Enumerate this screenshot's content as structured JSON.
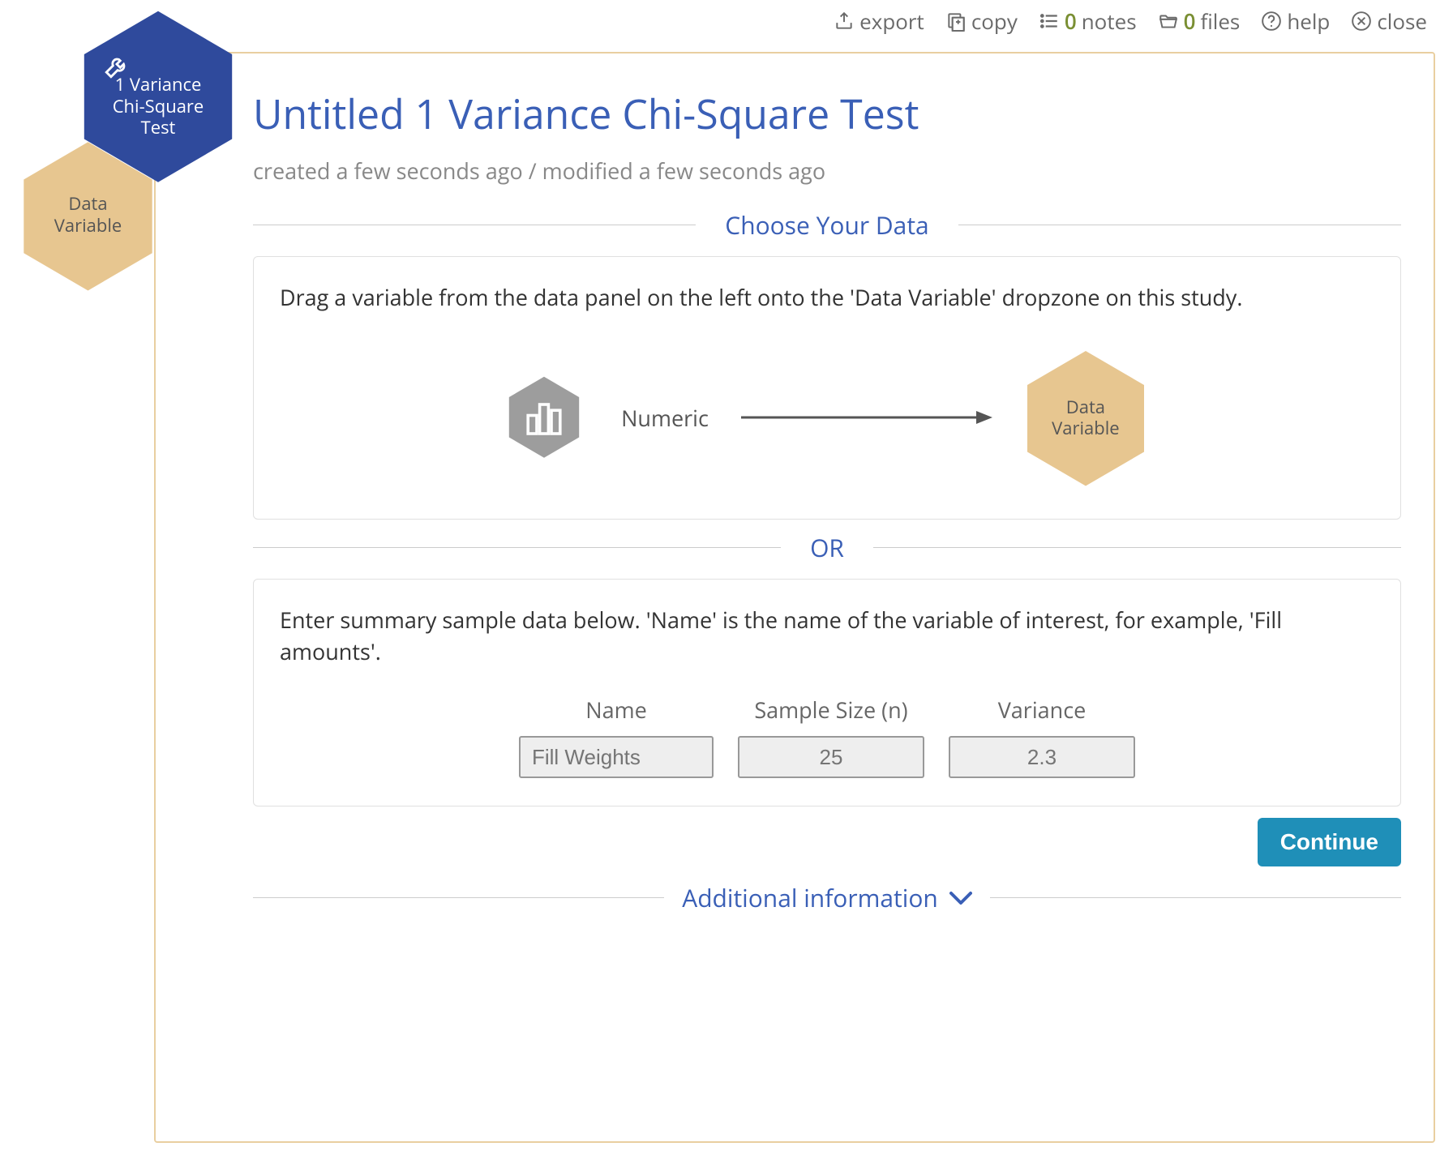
{
  "toolbar": {
    "export": "export",
    "copy": "copy",
    "notes_count": "0",
    "notes_label": "notes",
    "files_count": "0",
    "files_label": "files",
    "help": "help",
    "close": "close"
  },
  "side": {
    "test_line1": "1 Variance",
    "test_line2": "Chi-Square",
    "test_line3": "Test",
    "data_var_line1": "Data",
    "data_var_line2": "Variable"
  },
  "title": "Untitled 1 Variance Chi-Square Test",
  "meta": "created a few seconds ago / modified a few seconds ago",
  "sections": {
    "choose_data": "Choose Your Data",
    "or": "OR",
    "additional": "Additional information"
  },
  "drag": {
    "instruction": "Drag a variable from the data panel on the left onto the 'Data Variable' dropzone on this study.",
    "numeric_label": "Numeric",
    "dropzone_line1": "Data",
    "dropzone_line2": "Variable"
  },
  "summary": {
    "instruction": "Enter summary sample data below. 'Name' is the name of the variable of interest, for example, 'Fill amounts'.",
    "headers": {
      "name": "Name",
      "n": "Sample Size (n)",
      "var": "Variance"
    },
    "placeholders": {
      "name": "Fill Weights",
      "n": "25",
      "var": "2.3"
    }
  },
  "buttons": {
    "continue": "Continue"
  }
}
